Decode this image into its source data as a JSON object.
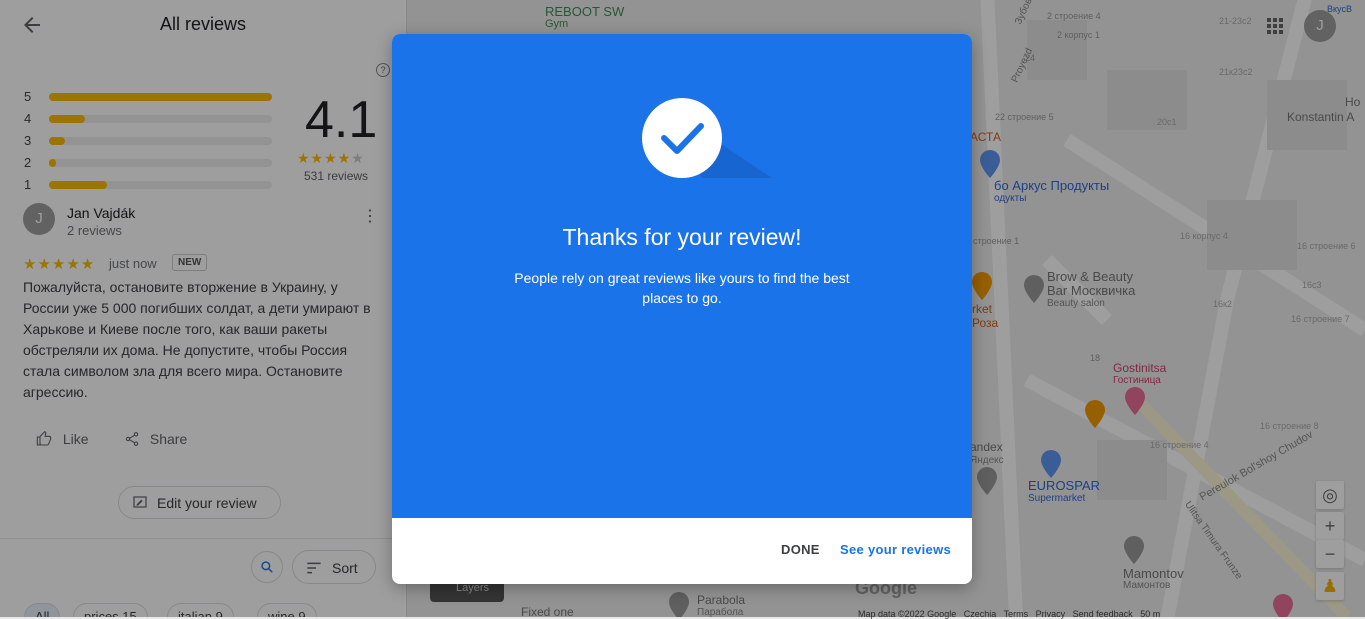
{
  "panel": {
    "title": "All reviews",
    "help": "?",
    "histogram": [
      {
        "star": "5",
        "fraction": 1.0
      },
      {
        "star": "4",
        "fraction": 0.16
      },
      {
        "star": "3",
        "fraction": 0.07
      },
      {
        "star": "2",
        "fraction": 0.03
      },
      {
        "star": "1",
        "fraction": 0.26
      }
    ],
    "rating": "4.1",
    "rating_stars": "★★★★",
    "rating_star_off": "★",
    "review_count": "531 reviews",
    "review": {
      "avatar_letter": "J",
      "user_name": "Jan Vajdák",
      "user_meta": "2 reviews",
      "stars": "★★★★★",
      "time": "just now",
      "badge": "NEW",
      "text": "Пожалуйста, остановите вторжение в Украину, у России уже 5 000 погибших солдат, а дети умирают в Харькове и Киеве после того, как ваши ракеты обстреляли их дома. Не допустите, чтобы Россия стала символом зла для всего мира. Остановите агрессию.",
      "like_label": "Like",
      "share_label": "Share",
      "edit_label": "Edit your review"
    },
    "sort_label": "Sort",
    "chips": [
      "All",
      "prices 15",
      "italian 9",
      "wine 9"
    ]
  },
  "map": {
    "labels": {
      "gym1": "REBOOT SW",
      "gym2": "Gym",
      "aracs1": "бо Аркус Продукты",
      "aracs2": "одукты",
      "brow1": "Brow & Beauty",
      "brow2": "Bar Москвичка",
      "brow3": "Beauty salon",
      "market1": "rket",
      "market2": "Роза",
      "gost1": "Gostinitsa",
      "gost2": "Гостиница",
      "andex1": "andex",
      "andex2": "Яндекс",
      "euro1": "EUROSPAR",
      "euro2": "Supermarket",
      "mamontov1": "Mamontov",
      "mamontov2": "Мамонтов",
      "parabola1": "Parabola",
      "parabola2": "Парабола",
      "fixed": "Fixed one",
      "konst": "Konstantin A",
      "konst2": "Но",
      "vkus": "ВкусВ",
      "chast": "АСТА",
      "proyezd": "Proyezd",
      "zubov": "Зубов",
      "pereulok": "Pereulok Bol'shoy Chudov",
      "frunze": "Ulitsa Timura Frunze",
      "b1": "2 строение 4",
      "b2": "2 корпус 1",
      "b3": "21-23с2",
      "b4": "21к23с2",
      "b5": "22 строение 5",
      "b6": "20с1",
      "b7": "16 корпус 4",
      "b8": "16 строение 6",
      "b9": "16 строение 7",
      "b10": "16к2",
      "b11": "16с3",
      "b12": "16 строение 4",
      "b13": "16 строение 8",
      "b14": "строение 1",
      "b15": "24",
      "b16": "18"
    },
    "google_logo": "Google",
    "layers": "Layers",
    "footer": [
      "Map data ©2022 Google",
      "Czechia",
      "Terms",
      "Privacy",
      "Send feedback",
      "50 m"
    ],
    "user_avatar": "J"
  },
  "dialog": {
    "title": "Thanks for your review!",
    "subtitle": "People rely on great reviews like yours to find the best places to go.",
    "done_label": "DONE",
    "see_label": "See your reviews",
    "accent_color": "#1a73e8"
  }
}
